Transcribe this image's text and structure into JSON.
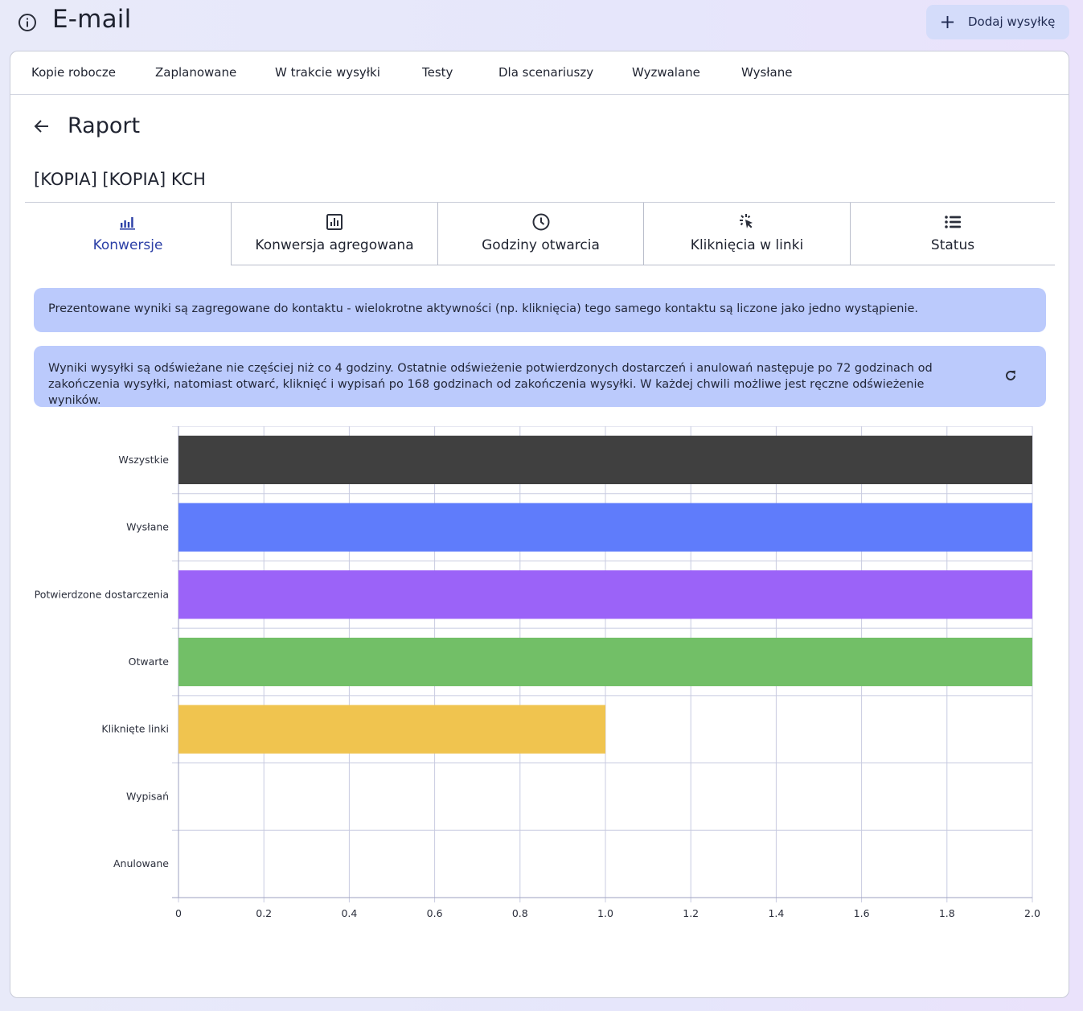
{
  "header": {
    "title": "E-mail",
    "add_button_label": "Dodaj wysyłkę"
  },
  "top_tabs": [
    {
      "label": "Kopie robocze"
    },
    {
      "label": "Zaplanowane"
    },
    {
      "label": "W trakcie wysyłki"
    },
    {
      "label": "Testy"
    },
    {
      "label": "Dla scenariuszy"
    },
    {
      "label": "Wyzwalane"
    },
    {
      "label": "Wysłane"
    }
  ],
  "report": {
    "title": "Raport",
    "campaign_name": "[KOPIA] [KOPIA] KCH"
  },
  "report_tabs": [
    {
      "label": "Konwersje",
      "icon": "bar-chart-icon",
      "active": true
    },
    {
      "label": "Konwersja agregowana",
      "icon": "analytics-icon",
      "active": false
    },
    {
      "label": "Godziny otwarcia",
      "icon": "clock-icon",
      "active": false
    },
    {
      "label": "Kliknięcia w linki",
      "icon": "cursor-click-icon",
      "active": false
    },
    {
      "label": "Status",
      "icon": "list-icon",
      "active": false
    }
  ],
  "alerts": {
    "aggregation": "Prezentowane wyniki są zagregowane do kontaktu - wielokrotne aktywności (np. kliknięcia) tego samego kontaktu są liczone jako jedno wystąpienie.",
    "refresh": "Wyniki wysyłki są odświeżane nie częściej niż co 4 godziny. Ostatnie odświeżenie potwierdzonych dostarczeń i anulowań następuje po 72 godzinach od zakończenia wysyłki, natomiast otwarć, kliknięć i wypisań po 168 godzinach od zakończenia wysyłki. W każdej chwili możliwe jest ręczne odświeżenie wyników."
  },
  "colors": {
    "accent": "#2b3fa6",
    "alert_bg": "#bbcafc",
    "button_bg": "#d4dcfa"
  },
  "chart_data": {
    "type": "bar",
    "orientation": "horizontal",
    "categories": [
      "Wszystkie",
      "Wysłane",
      "Potwierdzone dostarczenia",
      "Otwarte",
      "Kliknięte linki",
      "Wypisań",
      "Anulowane"
    ],
    "values": [
      2,
      2,
      2,
      2,
      1,
      0,
      0
    ],
    "colors": [
      "#404040",
      "#5f7cfb",
      "#9b63f8",
      "#72bf67",
      "#f0c44f",
      "#cccccc",
      "#cccccc"
    ],
    "xlim": [
      0,
      2
    ],
    "xticks": [
      "0",
      "0.2",
      "0.4",
      "0.6",
      "0.8",
      "1.0",
      "1.2",
      "1.4",
      "1.6",
      "1.8",
      "2.0"
    ],
    "grid": true,
    "title": "",
    "xlabel": "",
    "ylabel": ""
  }
}
